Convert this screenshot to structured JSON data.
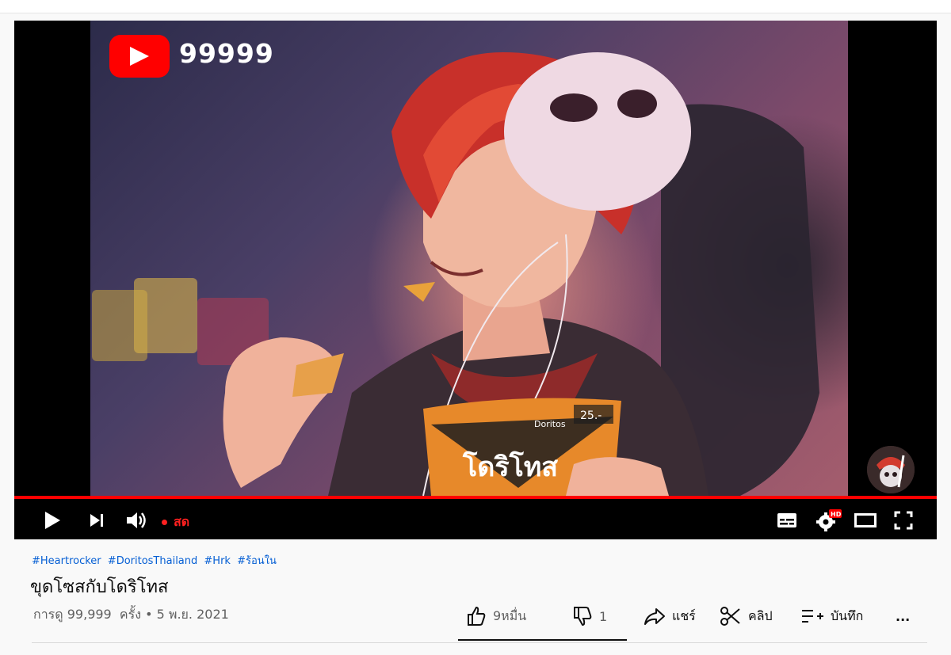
{
  "player": {
    "counter": "99999",
    "live_label": "สด",
    "icons": [
      "youtube-logo-icon",
      "play-icon",
      "next-icon",
      "volume-icon",
      "subtitles-icon",
      "settings-icon",
      "theater-mode-icon",
      "fullscreen-icon"
    ],
    "hd_badge": "HD",
    "progress": 1.0,
    "accent_color": "#ff0000"
  },
  "video": {
    "hashtags": [
      "#Heartrocker",
      "#DoritosThailand",
      "#Hrk",
      "#ร้อนใน"
    ],
    "title": "ขุดโซสกับโดริโทส",
    "views": "การดู 99,999",
    "views_suffix": "ครั้ง",
    "separator": "•",
    "date": "5 พ.ย. 2021"
  },
  "actions": {
    "like_count": "9หมื่น",
    "dislike_count": "1",
    "share_label": "แชร์",
    "clip_label": "คลิป",
    "save_label": "บันทึก",
    "more_label": "..."
  },
  "thumbnail": {
    "bag_price": "25.-",
    "bag_brand": "Doritos",
    "bag_label_thai": "โดริโทส"
  }
}
